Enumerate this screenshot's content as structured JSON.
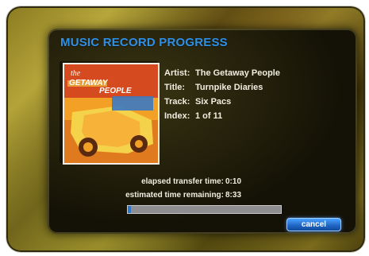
{
  "screen": {
    "title": "MUSIC RECORD PROGRESS"
  },
  "album": {
    "cover_text_line1": "the",
    "cover_text_line2": "GETAWAY",
    "cover_text_line3": "PEOPLE",
    "cover_colors": {
      "orange": "#f2a126",
      "red": "#d64a1f",
      "yellow": "#f4d34a",
      "blue": "#3b79c2"
    }
  },
  "track_info": {
    "artist_label": "Artist:",
    "artist_value": "The Getaway People",
    "title_label": "Title:",
    "title_value": "Turnpike Diaries",
    "track_label": "Track:",
    "track_value": "Six Pacs",
    "index_label": "Index:",
    "index_value": "1 of 11"
  },
  "transfer": {
    "elapsed_label": "elapsed transfer time:",
    "elapsed_value": "0:10",
    "remaining_label": "estimated time remaining:",
    "remaining_value": "8:33",
    "progress_fraction": 0.02
  },
  "buttons": {
    "cancel_label": "cancel"
  },
  "colors": {
    "title_blue": "#2f8fe6",
    "button_blue": "#1f63c2",
    "frame_olive": "#8a7b22"
  }
}
